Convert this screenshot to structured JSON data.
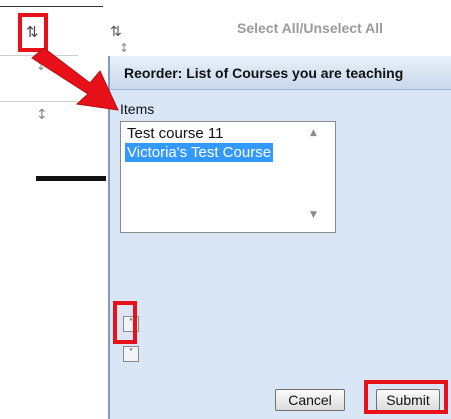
{
  "background": {
    "select_all_label": "Select All/Unselect All",
    "icons": {
      "reorder": "up-down-arrows-icon"
    }
  },
  "dialog": {
    "title": "Reorder: List of Courses you are teaching",
    "items_label": "Items",
    "items": [
      {
        "label": "Test course 11",
        "selected": false
      },
      {
        "label": "Victoria's Test Course",
        "selected": true
      }
    ],
    "buttons": {
      "cancel": "Cancel",
      "submit": "Submit"
    }
  },
  "colors": {
    "highlight_red": "#e8111a",
    "dialog_bg": "#d9e6f6",
    "selection_blue": "#3399ff"
  }
}
